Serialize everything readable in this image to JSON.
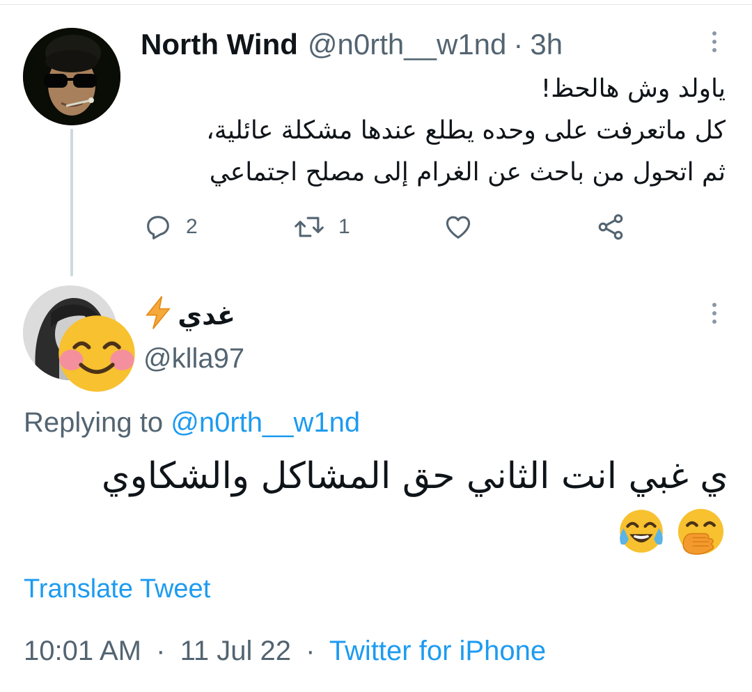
{
  "parent_tweet": {
    "author_name": "North Wind",
    "author_handle": "@n0rth__w1nd",
    "separator": "·",
    "time": "3h",
    "body_lines": [
      "ياولد وش هالحظ!",
      "كل ماتعرفت على وحده يطلع عندها مشكلة عائلية،",
      "ثم اتحول من باحث عن الغرام إلى مصلح اجتماعي"
    ],
    "reply_count": "2",
    "retweet_count": "1"
  },
  "reply_tweet": {
    "author_name": "غدي",
    "author_name_icon": "high-voltage-emoji",
    "author_handle": "@klla97",
    "replying_prefix": "Replying to",
    "replying_to": "@n0rth__w1nd",
    "body_text": "ي غبي انت الثاني حق المشاكل والشكاوي",
    "body_emojis": [
      "face-with-tears-of-joy-emoji",
      "face-with-hand-over-mouth-emoji"
    ],
    "avatar_overlay": "smiling-face-with-smiling-eyes-emoji",
    "translate_label": "Translate Tweet",
    "time": "10:01 AM",
    "date": "11 Jul 22",
    "source": "Twitter for iPhone",
    "separator": "·"
  },
  "colors": {
    "link_blue": "#1d9bf0",
    "secondary_text": "#536471",
    "primary_text": "#0f1419",
    "thread_line": "#cfd9de"
  }
}
